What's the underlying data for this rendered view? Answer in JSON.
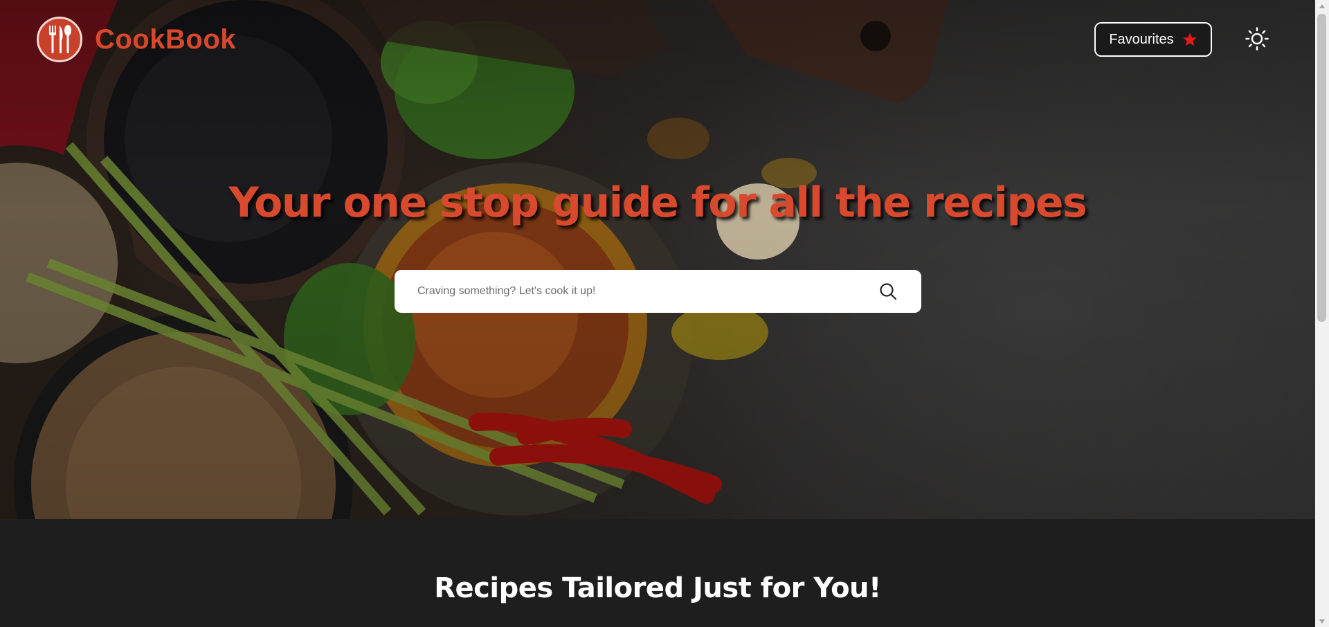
{
  "app": {
    "name": "CookBook"
  },
  "header": {
    "favourites_label": "Favourites",
    "theme_toggle_icon": "sun-icon",
    "logo_icon": "fork-knife-spoon-icon",
    "favourites_icon": "star-icon"
  },
  "hero": {
    "headline": "Your one stop guide for all the recipes",
    "search": {
      "placeholder": "Craving something? Let's cook it up!",
      "value": "",
      "icon": "search-icon"
    }
  },
  "section": {
    "title": "Recipes Tailored Just for You!"
  },
  "colors": {
    "brand": "#d8482c",
    "header_button_bg": "#1a1a1a",
    "star": "#e21b1b",
    "section_bg": "#1e1e1e",
    "text_light": "#ffffff"
  }
}
